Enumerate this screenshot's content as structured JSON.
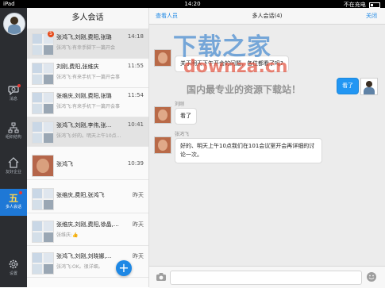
{
  "status_bar": {
    "carrier": "iPad",
    "time": "14:20",
    "battery": "不在充电"
  },
  "nav": {
    "items": [
      {
        "label": "消息"
      },
      {
        "label": "组织结构"
      },
      {
        "label": "友好企业"
      },
      {
        "label": "多人会话"
      },
      {
        "label": "设置"
      }
    ]
  },
  "conversation_list": {
    "title": "多人会话",
    "rows": [
      {
        "name": "张鸿飞,刘刚,费阳,张璐",
        "preview": "张鸿飞:有幸手脚下一篇开会",
        "time": "14:18",
        "badge": "5"
      },
      {
        "name": "刘刚,费阳,张维庆",
        "preview": "张鸿飞:有来手机下一篇开会事",
        "time": "11:55"
      },
      {
        "name": "张维庆,刘刚,费阳,张璐",
        "preview": "张鸿飞:有来手机下一篇开会事",
        "time": "11:54"
      },
      {
        "name": "张鸿飞,刘刚,李伟,张...",
        "preview": "张鸿飞:好的。明天上午10点...",
        "time": "10:41"
      },
      {
        "name": "张鸿飞",
        "preview": "",
        "time": "10:39"
      },
      {
        "name": "张维庆,费阳,张鸿飞",
        "preview": "",
        "time": "昨天"
      },
      {
        "name": "张维庆,刘刚,费阳,徐晶,刘...",
        "preview": "张维庆:👍",
        "time": "昨天"
      },
      {
        "name": "张鸿飞,刘刚,刘晓娜,...",
        "preview": "张鸿飞:OK。很详细。",
        "time": "昨天"
      }
    ]
  },
  "chat": {
    "view_members": "查看人员",
    "title": "多人会话(4)",
    "close": "关闭",
    "messages": [
      {
        "sender": "",
        "text": "关于明天下午开会的问题，各位都看了吗?"
      },
      {
        "sender": "",
        "text": "看了",
        "mine": true
      },
      {
        "sender": "刘刚",
        "text": "看了"
      },
      {
        "sender": "张鸿飞",
        "text": "好的、明天上午10点我们在101会议室开会再详细的讨论一次。"
      }
    ]
  },
  "watermark": {
    "line1": "下载之家",
    "line2": "downza.cn",
    "line3": "国内最专业的资源下载站！"
  },
  "colors": {
    "accent": "#1e88e5",
    "nav_bg": "#2b2d31",
    "badge": "#e64a19"
  }
}
